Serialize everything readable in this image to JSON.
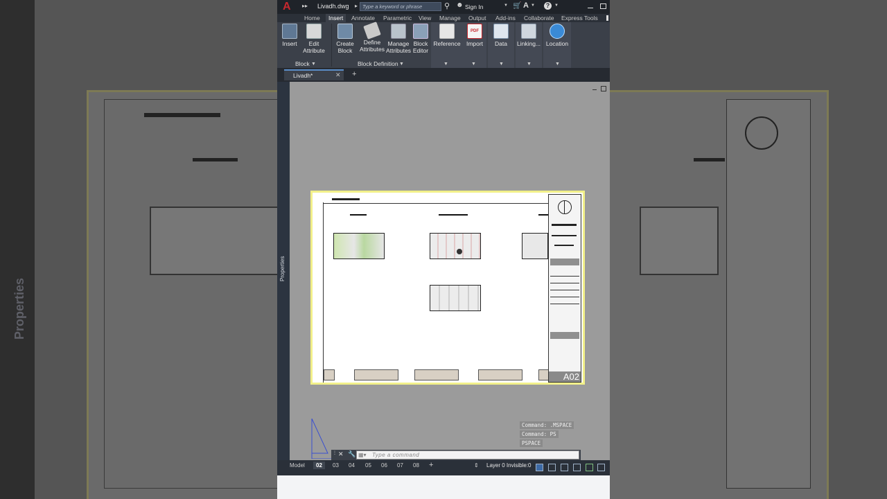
{
  "background": {
    "left_panel_label": "Properties"
  },
  "titlebar": {
    "app_logo": "A",
    "file_name": "Livadh.dwg",
    "search_placeholder": "Type a keyword or phrase",
    "sign_in": "Sign In"
  },
  "menu_tabs": [
    "Home",
    "Insert",
    "Annotate",
    "Parametric",
    "View",
    "Manage",
    "Output",
    "Add-ins",
    "Collaborate",
    "Express Tools"
  ],
  "active_tab": "Insert",
  "ribbon": {
    "insert": "Insert",
    "edit_attribute_1": "Edit",
    "edit_attribute_2": "Attribute",
    "create_block_1": "Create",
    "create_block_2": "Block",
    "define_attributes_1": "Define",
    "define_attributes_2": "Attributes",
    "manage_attributes_1": "Manage",
    "manage_attributes_2": "Attributes",
    "block_editor_1": "Block",
    "block_editor_2": "Editor",
    "reference": "Reference",
    "import": "Import",
    "data": "Data",
    "linking": "Linking...",
    "location": "Location",
    "group_block": "Block",
    "group_block_definition": "Block Definition",
    "pdf_label": "PDF"
  },
  "document_tab": "Livadh*",
  "properties_label": "Properties",
  "sheet": {
    "title_block_number": "A02"
  },
  "command_history": [
    "Command: .MSPACE",
    "Command: PS",
    "PSPACE"
  ],
  "command_placeholder": "Type a command",
  "layout_tabs": [
    "Model",
    "02",
    "03",
    "04",
    "05",
    "06",
    "07",
    "08"
  ],
  "active_layout": "02",
  "status": {
    "layer": "Layer 0 Invisible:0"
  },
  "colors": {
    "accent_red": "#c8282e",
    "sheet_border": "#f2f08a",
    "ribbon_bg": "#3b4049"
  }
}
